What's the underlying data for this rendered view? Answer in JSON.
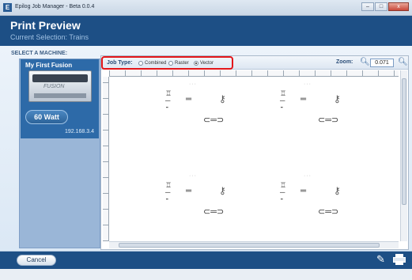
{
  "window": {
    "title": "Epilog Job Manager - Beta 0.0.4",
    "app_icon": "E",
    "minimize": "–",
    "maximize": "□",
    "close": "x"
  },
  "header": {
    "title": "Print Preview",
    "subtitle": "Current Selection: Trains"
  },
  "sidebar": {
    "heading": "SELECT A MACHINE:",
    "machine": {
      "name": "My First Fusion",
      "logo": "FUSION",
      "power": "60 Watt",
      "ip": "192.168.3.4"
    }
  },
  "toolbar": {
    "job_type_label": "Job Type:",
    "options": [
      {
        "label": "Combined",
        "selected": false
      },
      {
        "label": "Raster",
        "selected": false
      },
      {
        "label": "Vector",
        "selected": true
      }
    ],
    "zoom_label": "Zoom:",
    "zoom_value": "0.071",
    "zoom_out_icon": "zoom-out-icon",
    "zoom_in_icon": "zoom-in-icon",
    "highlight_color": "#e3161a"
  },
  "footer": {
    "cancel_label": "Cancel",
    "edit_icon": "pencil-icon",
    "print_icon": "printer-icon"
  },
  "colors": {
    "header_bg": "#1d4f85",
    "accent": "#2d6aa8",
    "panel": "#9ab6d7"
  }
}
